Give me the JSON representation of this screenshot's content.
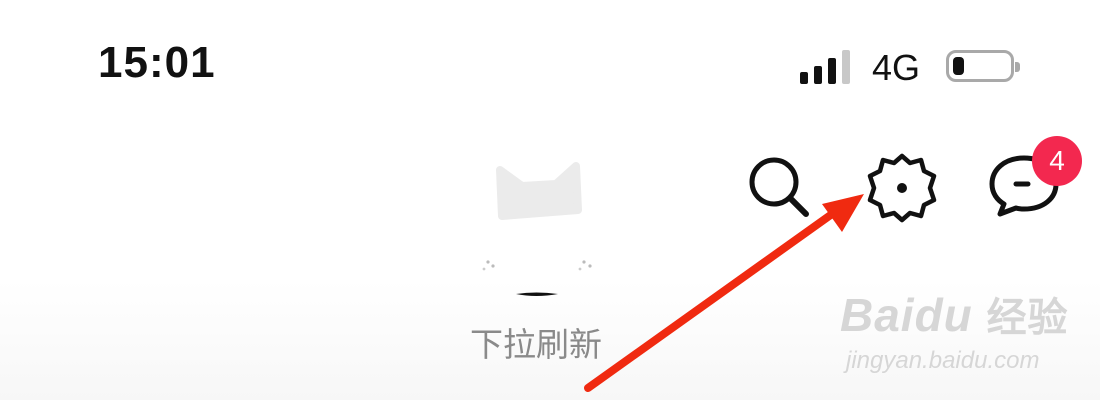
{
  "status_bar": {
    "time": "15:01",
    "network": "4G",
    "signal_bars_active": 3,
    "signal_bars_total": 4,
    "battery_level": 0.2
  },
  "toolbar": {
    "search_icon": "search-icon",
    "settings_icon": "settings-icon",
    "messages_icon": "message-icon",
    "messages_badge": "4"
  },
  "pull_refresh": {
    "label": "下拉刷新"
  },
  "watermark": {
    "brand": "Baidu",
    "brand_cn": "经验",
    "url": "jingyan.baidu.com"
  },
  "colors": {
    "badge": "#f3284f",
    "arrow": "#f02a10",
    "label": "#8a8a8a"
  }
}
